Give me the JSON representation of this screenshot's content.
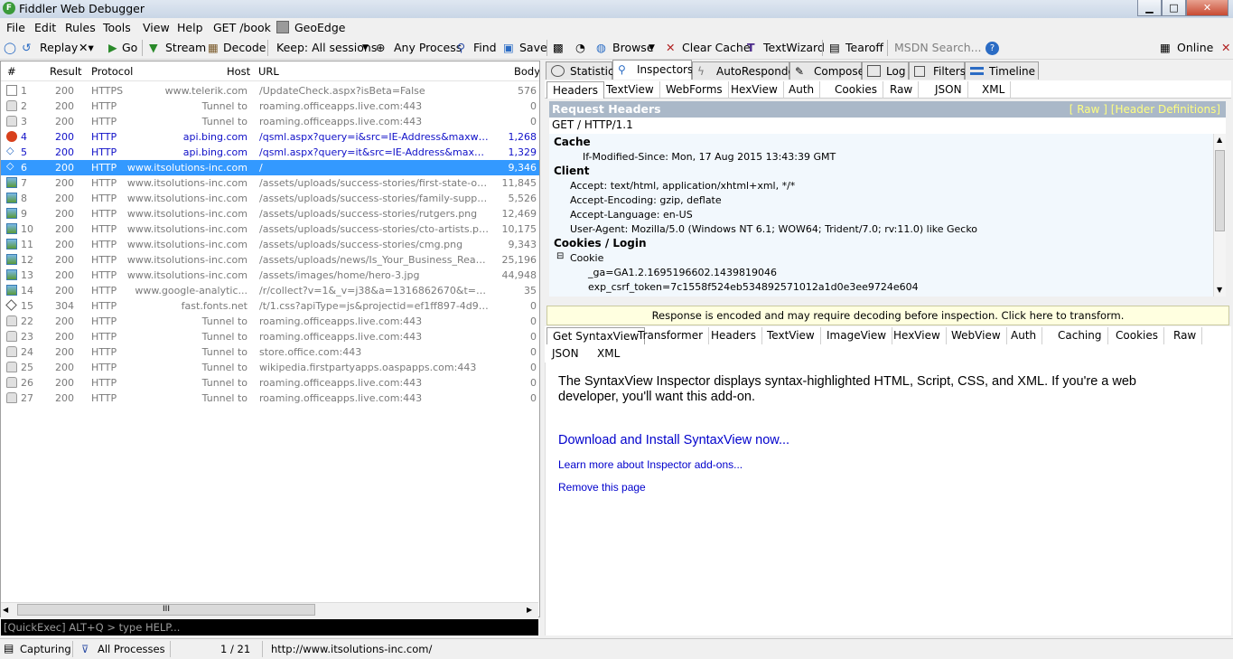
{
  "window": {
    "title": "Fiddler Web Debugger",
    "logo_letter": "F",
    "min": "▁",
    "max": "□",
    "close": "✕"
  },
  "menu": [
    "File",
    "Edit",
    "Rules",
    "Tools",
    "View",
    "Help",
    "GET /book",
    "GeoEdge"
  ],
  "toolbar": {
    "replay": "Replay",
    "go": "Go",
    "stream": "Stream",
    "decode": "Decode",
    "keep": "Keep: All sessions",
    "process": "Any Process",
    "find": "Find",
    "save": "Save",
    "browse": "Browse",
    "clear_cache": "Clear Cache",
    "textwizard": "TextWizard",
    "tearoff": "Tearoff",
    "search_placeholder": "MSDN Search...",
    "online": "Online"
  },
  "columns": [
    "#",
    "Result",
    "Protocol",
    "Host",
    "URL",
    "Body"
  ],
  "sessions": [
    {
      "id": "1",
      "result": "200",
      "protocol": "HTTPS",
      "host": "www.telerik.com",
      "url": "/UpdateCheck.aspx?isBeta=False",
      "body": "576",
      "style": "gray",
      "icon": "page"
    },
    {
      "id": "2",
      "result": "200",
      "protocol": "HTTP",
      "host": "Tunnel to",
      "url": "roaming.officeapps.live.com:443",
      "body": "0",
      "style": "gray",
      "icon": "lock"
    },
    {
      "id": "3",
      "result": "200",
      "protocol": "HTTP",
      "host": "Tunnel to",
      "url": "roaming.officeapps.live.com:443",
      "body": "0",
      "style": "gray",
      "icon": "lock"
    },
    {
      "id": "4",
      "result": "200",
      "protocol": "HTTP",
      "host": "api.bing.com",
      "url": "/qsml.aspx?query=i&src=IE-Address&maxwidth=3...",
      "body": "1,268",
      "style": "blue",
      "icon": "block"
    },
    {
      "id": "5",
      "result": "200",
      "protocol": "HTTP",
      "host": "api.bing.com",
      "url": "/qsml.aspx?query=it&src=IE-Address&maxwidth=...",
      "body": "1,329",
      "style": "blue",
      "icon": "code"
    },
    {
      "id": "6",
      "result": "200",
      "protocol": "HTTP",
      "host": "www.itsolutions-inc.com",
      "url": "/",
      "body": "9,346",
      "style": "sel",
      "icon": "code"
    },
    {
      "id": "7",
      "result": "200",
      "protocol": "HTTP",
      "host": "www.itsolutions-inc.com",
      "url": "/assets/uploads/success-stories/first-state-ortho....",
      "body": "11,845",
      "style": "gray",
      "icon": "img"
    },
    {
      "id": "8",
      "result": "200",
      "protocol": "HTTP",
      "host": "www.itsolutions-inc.com",
      "url": "/assets/uploads/success-stories/family-support-se...",
      "body": "5,526",
      "style": "gray",
      "icon": "img"
    },
    {
      "id": "9",
      "result": "200",
      "protocol": "HTTP",
      "host": "www.itsolutions-inc.com",
      "url": "/assets/uploads/success-stories/rutgers.png",
      "body": "12,469",
      "style": "gray",
      "icon": "img"
    },
    {
      "id": "10",
      "result": "200",
      "protocol": "HTTP",
      "host": "www.itsolutions-inc.com",
      "url": "/assets/uploads/success-stories/cto-artists.png",
      "body": "10,175",
      "style": "gray",
      "icon": "img"
    },
    {
      "id": "11",
      "result": "200",
      "protocol": "HTTP",
      "host": "www.itsolutions-inc.com",
      "url": "/assets/uploads/success-stories/cmg.png",
      "body": "9,343",
      "style": "gray",
      "icon": "img"
    },
    {
      "id": "12",
      "result": "200",
      "protocol": "HTTP",
      "host": "www.itsolutions-inc.com",
      "url": "/assets/uploads/news/Is_Your_Business_Ready_s...",
      "body": "25,196",
      "style": "gray",
      "icon": "img"
    },
    {
      "id": "13",
      "result": "200",
      "protocol": "HTTP",
      "host": "www.itsolutions-inc.com",
      "url": "/assets/images/home/hero-3.jpg",
      "body": "44,948",
      "style": "gray",
      "icon": "img"
    },
    {
      "id": "14",
      "result": "200",
      "protocol": "HTTP",
      "host": "www.google-analytic...",
      "url": "/r/collect?v=1&_v=j38&a=1316862670&t=pagevi...",
      "body": "35",
      "style": "gray",
      "icon": "img"
    },
    {
      "id": "15",
      "result": "304",
      "protocol": "HTTP",
      "host": "fast.fonts.net",
      "url": "/t/1.css?apiType=js&projectid=ef1ff897-4d9f-49b...",
      "body": "0",
      "style": "gray",
      "icon": "diamond"
    },
    {
      "id": "22",
      "result": "200",
      "protocol": "HTTP",
      "host": "Tunnel to",
      "url": "roaming.officeapps.live.com:443",
      "body": "0",
      "style": "gray",
      "icon": "lock"
    },
    {
      "id": "23",
      "result": "200",
      "protocol": "HTTP",
      "host": "Tunnel to",
      "url": "roaming.officeapps.live.com:443",
      "body": "0",
      "style": "gray",
      "icon": "lock"
    },
    {
      "id": "24",
      "result": "200",
      "protocol": "HTTP",
      "host": "Tunnel to",
      "url": "store.office.com:443",
      "body": "0",
      "style": "gray",
      "icon": "lock"
    },
    {
      "id": "25",
      "result": "200",
      "protocol": "HTTP",
      "host": "Tunnel to",
      "url": "wikipedia.firstpartyapps.oaspapps.com:443",
      "body": "0",
      "style": "gray",
      "icon": "lock"
    },
    {
      "id": "26",
      "result": "200",
      "protocol": "HTTP",
      "host": "Tunnel to",
      "url": "roaming.officeapps.live.com:443",
      "body": "0",
      "style": "gray",
      "icon": "lock"
    },
    {
      "id": "27",
      "result": "200",
      "protocol": "HTTP",
      "host": "Tunnel to",
      "url": "roaming.officeapps.live.com:443",
      "body": "0",
      "style": "gray",
      "icon": "lock"
    }
  ],
  "hscroll_grip": "III",
  "quickexec": "[QuickExec] ALT+Q > type HELP...",
  "right_tabs": [
    "Statistics",
    "Inspectors",
    "AutoResponder",
    "Composer",
    "Log",
    "Filters",
    "Timeline"
  ],
  "request_tabs": [
    "Headers",
    "TextView",
    "WebForms",
    "HexView",
    "Auth",
    "Cookies",
    "Raw",
    "JSON",
    "XML"
  ],
  "request": {
    "title": "Request Headers",
    "links": "[ Raw ]   [Header Definitions]",
    "line": "GET / HTTP/1.1",
    "groups": {
      "cache": "Cache",
      "cache_1": "If-Modified-Since: Mon, 17 Aug 2015 13:43:39 GMT",
      "client": "Client",
      "client_1": "Accept: text/html, application/xhtml+xml, */*",
      "client_2": "Accept-Encoding: gzip, deflate",
      "client_3": "Accept-Language: en-US",
      "client_4": "User-Agent: Mozilla/5.0 (Windows NT 6.1; WOW64; Trident/7.0; rv:11.0) like Gecko",
      "cookies": "Cookies / Login",
      "cookie": "Cookie",
      "cookie_1": "_ga=GA1.2.1695196602.1439819046",
      "cookie_2": "exp_csrf_token=7c1558f524eb534892571012a1d0e3ee9724e604"
    }
  },
  "banner": "Response is encoded and may require decoding before inspection. Click here to transform.",
  "response_tabs": [
    "Get SyntaxView",
    "Transformer",
    "Headers",
    "TextView",
    "ImageView",
    "HexView",
    "WebView",
    "Auth",
    "Caching",
    "Cookies",
    "Raw"
  ],
  "response_tabs2": [
    "JSON",
    "XML"
  ],
  "syntaxview": {
    "text": "The SyntaxView Inspector displays syntax-highlighted HTML, Script, CSS, and XML. If you're a web developer, you'll want this add-on.",
    "download": "Download and Install SyntaxView now...",
    "learn": "Learn more about Inspector add-ons...",
    "remove": "Remove this page"
  },
  "status": {
    "capturing": "Capturing",
    "processes": "All Processes",
    "count": "1 / 21",
    "url": "http://www.itsolutions-inc.com/"
  }
}
